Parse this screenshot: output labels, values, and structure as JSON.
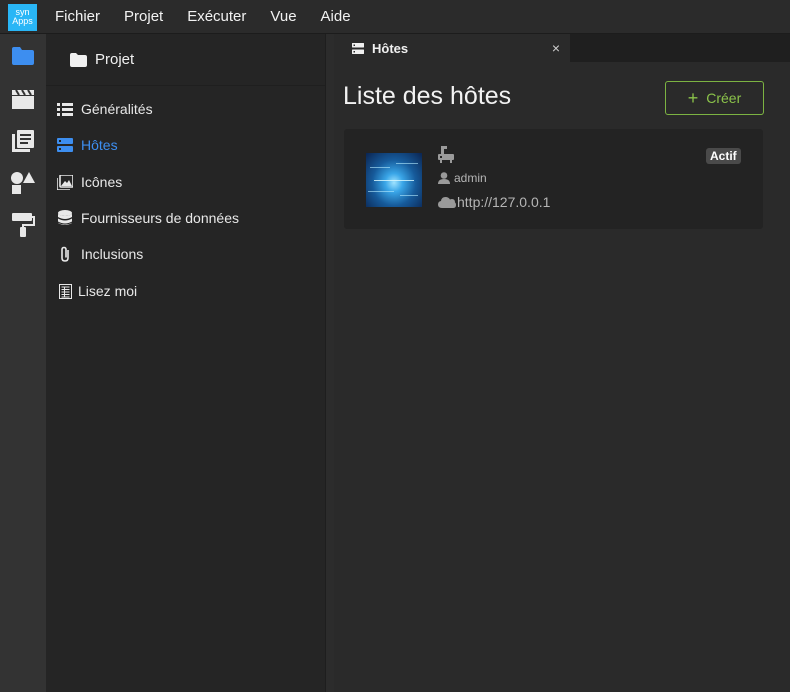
{
  "app": {
    "logo_line1": "syn",
    "logo_line2": "Apps"
  },
  "menubar": {
    "items": [
      "Fichier",
      "Projet",
      "Exécuter",
      "Vue",
      "Aide"
    ]
  },
  "activity_bar": {
    "icons": [
      "folder-icon",
      "clapperboard-icon",
      "library-icon",
      "shapes-icon",
      "paint-roller-icon"
    ],
    "active": "folder-icon"
  },
  "sidebar": {
    "title": "Projet",
    "items": [
      {
        "label": "Généralités",
        "icon": "list-icon"
      },
      {
        "label": "Hôtes",
        "icon": "server-icon",
        "active": true
      },
      {
        "label": "Icônes",
        "icon": "image-icon"
      },
      {
        "label": "Fournisseurs de données",
        "icon": "database-icon"
      },
      {
        "label": "Inclusions",
        "icon": "paperclip-icon"
      },
      {
        "label": "Lisez moi",
        "icon": "document-icon"
      }
    ]
  },
  "tab": {
    "label": "Hôtes",
    "close": "×"
  },
  "main": {
    "title": "Liste des hôtes",
    "create_label": "Créer",
    "hosts": [
      {
        "user": "admin",
        "url": "http://127.0.0.1",
        "status": "Actif"
      }
    ]
  },
  "colors": {
    "accent": "#3d8ef0",
    "create": "#8bc34a",
    "logo": "#29b6f6"
  }
}
